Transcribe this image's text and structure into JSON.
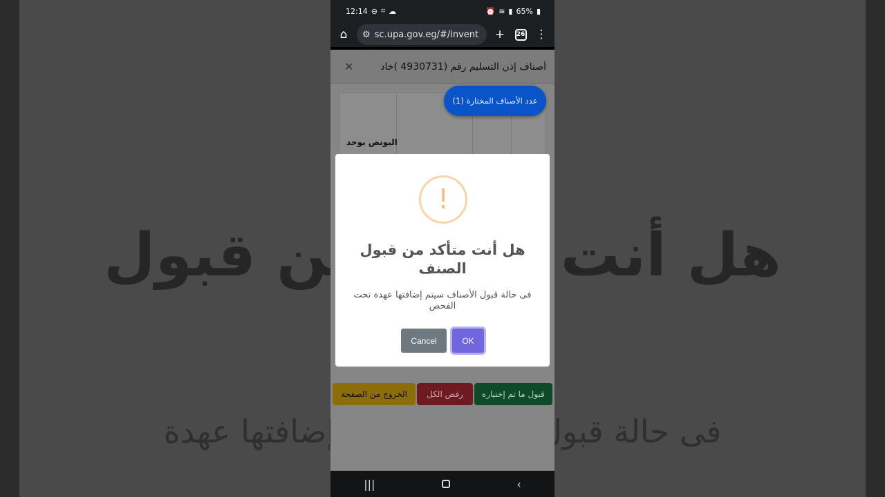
{
  "background": {
    "title": "هل أنت متأكد من قبول",
    "subtitle": "فى حالة قبول الأصناف سيتم إضافتها عهدة"
  },
  "statusbar": {
    "time": "12:14",
    "battery": "65%"
  },
  "browser": {
    "url": "sc.upa.gov.eg/#/invent",
    "tab_count": "26"
  },
  "modal": {
    "title": "أصناف إذن التسليم رقم (4930731 )خاد",
    "selected_pill": "عدد الأصناف المختارة (1)",
    "bonus_column": "البونص بوحد"
  },
  "actions": {
    "exit": "الخروج من الصفحة",
    "reject_all": "رفض الكل",
    "accept_selected": "قبول ما تم إختياره"
  },
  "dialog": {
    "icon": "!",
    "title": "هل أنت متأكد من قبول الصنف",
    "text": "فى حالة قبول الأصناف سيتم إضافتها عهدة تحت الفحص",
    "cancel": "Cancel",
    "ok": "OK"
  },
  "colors": {
    "ok_button": "#7066e0",
    "cancel_button": "#6e7881",
    "warning_icon": "#f8bb86",
    "pill": "#0d6efd"
  }
}
